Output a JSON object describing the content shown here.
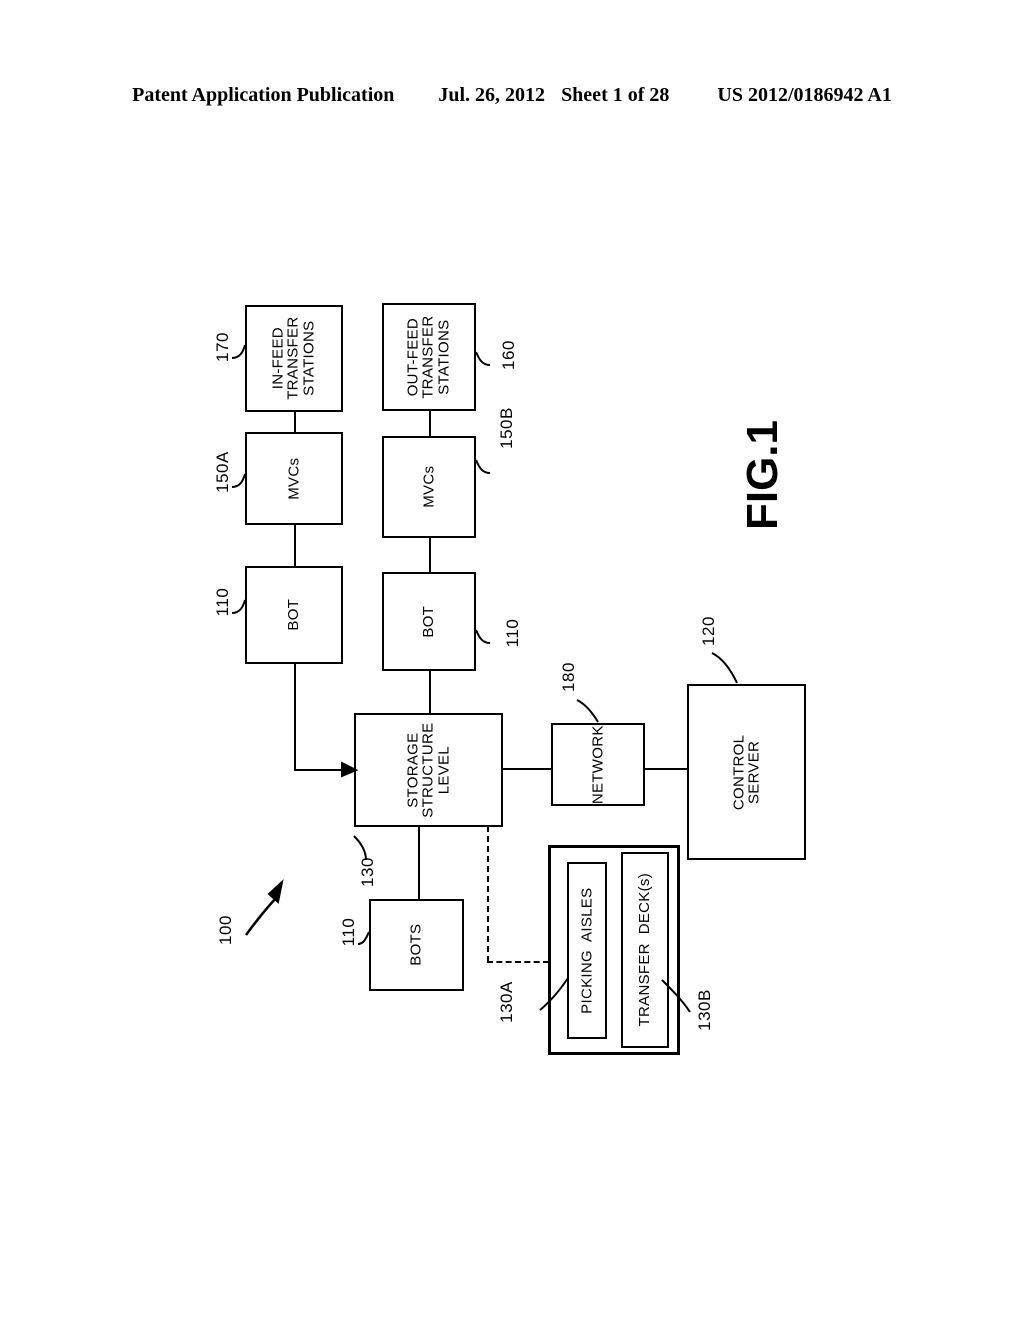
{
  "header": {
    "publication": "Patent Application Publication",
    "date": "Jul. 26, 2012",
    "sheet": "Sheet 1 of 28",
    "docnum": "US 2012/0186942 A1"
  },
  "figure": {
    "caption": "FIG.1",
    "system_ref": "100",
    "nodes": [
      {
        "id": "in-feed-transfer-stations",
        "label": "IN-FEED\nTRANSFER\nSTATIONS",
        "ref": "170"
      },
      {
        "id": "out-feed-transfer-stations",
        "label": "OUT-FEED\nTRANSFER\nSTATIONS",
        "ref": "160"
      },
      {
        "id": "mvcs-in",
        "label": "MVCs",
        "ref": "150A"
      },
      {
        "id": "mvcs-out",
        "label": "MVCs",
        "ref": "150B"
      },
      {
        "id": "bot-in",
        "label": "BOT",
        "ref": "110"
      },
      {
        "id": "bot-out",
        "label": "BOT",
        "ref": "110"
      },
      {
        "id": "storage-structure-level",
        "label": "STORAGE\nSTRUCTURE\nLEVEL",
        "ref": "130"
      },
      {
        "id": "bots",
        "label": "BOTS",
        "ref": "110"
      },
      {
        "id": "network",
        "label": "NETWORK",
        "ref": "180"
      },
      {
        "id": "control-server",
        "label": "CONTROL\nSERVER",
        "ref": "120"
      },
      {
        "id": "picking-aisles",
        "label": "PICKING  AISLES",
        "ref": "130A"
      },
      {
        "id": "transfer-decks",
        "label": "TRANSFER  DECK(s)",
        "ref": "130B"
      }
    ]
  }
}
